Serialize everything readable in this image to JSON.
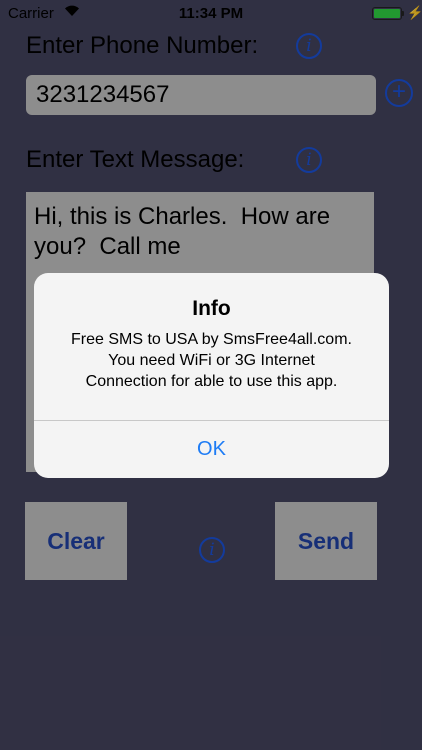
{
  "status_bar": {
    "carrier": "Carrier",
    "time": "11:34 PM",
    "battery_level": 1.0
  },
  "phone": {
    "label": "Enter Phone Number:",
    "value": "3231234567"
  },
  "message": {
    "label": "Enter Text Message:",
    "value": "Hi, this is Charles.  How are\nyou?  Call me"
  },
  "buttons": {
    "clear": "Clear",
    "send": "Send"
  },
  "icons": {
    "info": "i",
    "add": "+"
  },
  "alert": {
    "title": "Info",
    "message": "Free SMS to USA by SmsFree4all.com.\nYou need WiFi or 3G Internet\nConnection for able to use this app.",
    "ok": "OK"
  },
  "colors": {
    "background": "#41405a",
    "field": "#bdbdbd",
    "button_text": "#1f3f9f",
    "accent": "#1e7cf5",
    "info_icon": "#1a4fd1"
  }
}
